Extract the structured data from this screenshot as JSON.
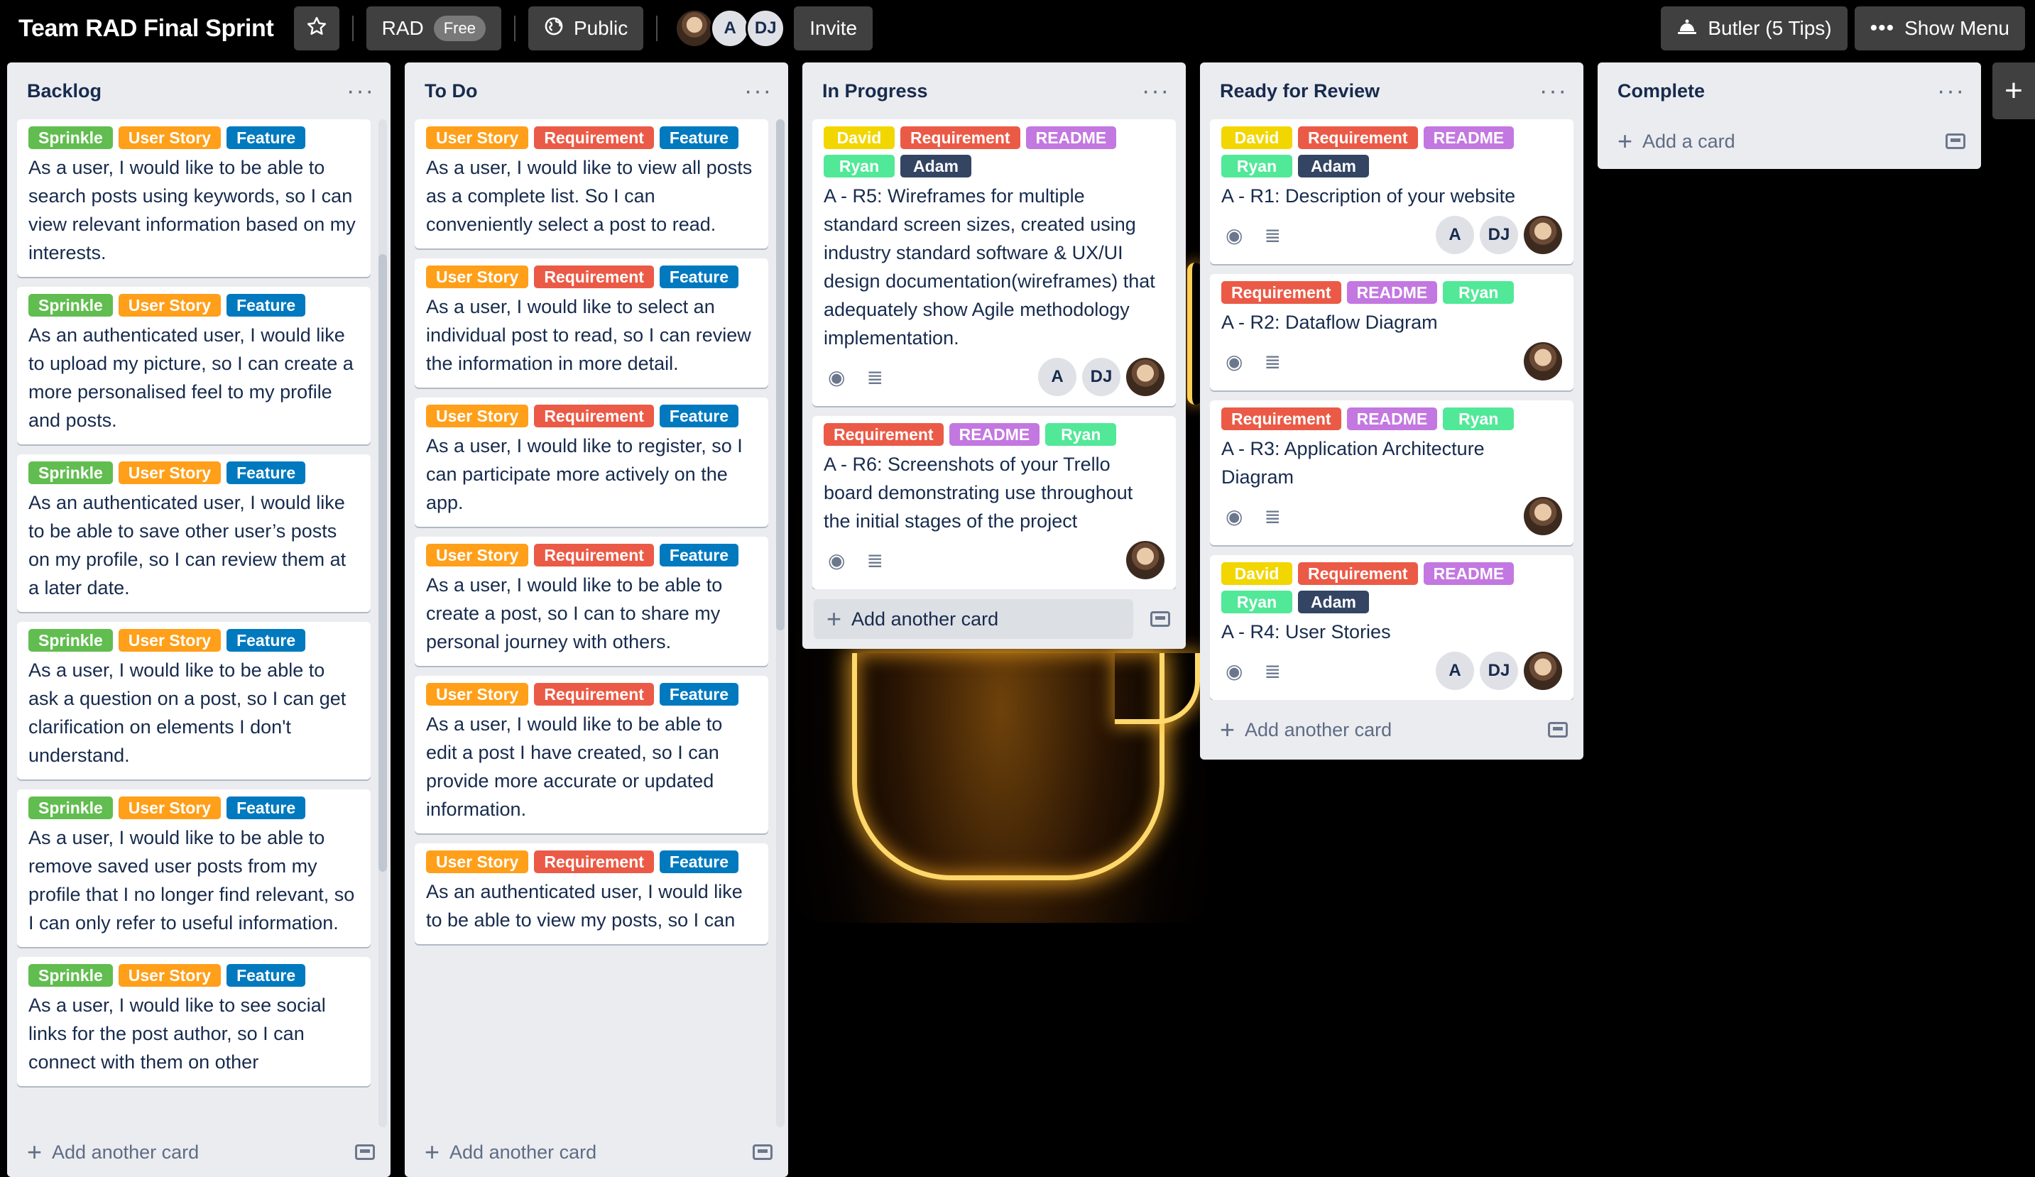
{
  "colors": {
    "sprinkle": "#61bd4f",
    "user_story": "#ff9f1a",
    "feature": "#0079bf",
    "requirement": "#eb5a46",
    "readme": "#c377e0",
    "david": "#f2d600",
    "ryan": "#51e898",
    "adam": "#344563"
  },
  "header": {
    "board_title": "Team RAD Final Sprint",
    "star_icon": "star-icon",
    "workspace": "RAD",
    "plan_badge": "Free",
    "visibility": "Public",
    "members": [
      "A",
      "DJ"
    ],
    "invite": "Invite",
    "butler": "Butler (5 Tips)",
    "show_menu": "Show Menu"
  },
  "lists": {
    "backlog": {
      "title": "Backlog",
      "add_card": "Add another card",
      "cards": [
        {
          "labels": [
            "Sprinkle",
            "User Story",
            "Feature"
          ],
          "text": "As a user, I would like to be able to search posts using keywords, so I can view relevant information based on my interests."
        },
        {
          "labels": [
            "Sprinkle",
            "User Story",
            "Feature"
          ],
          "text": "As an authenticated user, I would like to upload my picture, so I can create a more personalised feel to my profile and posts."
        },
        {
          "labels": [
            "Sprinkle",
            "User Story",
            "Feature"
          ],
          "text": "As an authenticated user, I would like to be able to save other user’s posts on my profile, so I can review them at a later date."
        },
        {
          "labels": [
            "Sprinkle",
            "User Story",
            "Feature"
          ],
          "text": "As a user, I would like to be able to ask a question on a post, so I can get clarification on elements I don't understand."
        },
        {
          "labels": [
            "Sprinkle",
            "User Story",
            "Feature"
          ],
          "text": "As a user, I would like to be able to remove saved user posts from my profile that I no longer find relevant, so I can only refer to useful information."
        },
        {
          "labels": [
            "Sprinkle",
            "User Story",
            "Feature"
          ],
          "text": "As a user, I would like to see social links for the post author, so I can connect with them on other"
        }
      ]
    },
    "todo": {
      "title": "To Do",
      "add_card": "Add another card",
      "cards": [
        {
          "labels": [
            "User Story",
            "Requirement",
            "Feature"
          ],
          "text": "As a user, I would like to view all posts as a complete list. So I can conveniently select a post to read."
        },
        {
          "labels": [
            "User Story",
            "Requirement",
            "Feature"
          ],
          "text": "As a user, I would like to select an individual post to read, so I can review the information in more detail."
        },
        {
          "labels": [
            "User Story",
            "Requirement",
            "Feature"
          ],
          "text": "As a user, I would like to register, so I can participate more actively on the app."
        },
        {
          "labels": [
            "User Story",
            "Requirement",
            "Feature"
          ],
          "text": "As a user, I would like to be able to create a post, so I can to share my personal journey with others."
        },
        {
          "labels": [
            "User Story",
            "Requirement",
            "Feature"
          ],
          "text": "As a user, I would like to be able to edit a post I have created, so I can provide more accurate or updated information."
        },
        {
          "labels": [
            "User Story",
            "Requirement",
            "Feature"
          ],
          "text": "As an authenticated user, I would like to be able to view my posts, so I can"
        }
      ]
    },
    "in_progress": {
      "title": "In Progress",
      "add_card": "Add another card",
      "cards": [
        {
          "labels": [
            "David",
            "Requirement",
            "README",
            "Ryan",
            "Adam"
          ],
          "text": "A - R5: Wireframes for multiple standard screen sizes, created using industry standard software & UX/UI design documentation(wireframes) that adequately show Agile methodology implementation.",
          "members": [
            "A",
            "DJ"
          ]
        },
        {
          "labels": [
            "Requirement",
            "README",
            "Ryan"
          ],
          "text": "A - R6: Screenshots of your Trello board demonstrating use throughout the initial stages of the project",
          "members": []
        }
      ]
    },
    "review": {
      "title": "Ready for Review",
      "add_card": "Add another card",
      "cards": [
        {
          "labels": [
            "David",
            "Requirement",
            "README",
            "Ryan",
            "Adam"
          ],
          "text": "A - R1: Description of your website",
          "members": [
            "A",
            "DJ"
          ]
        },
        {
          "labels": [
            "Requirement",
            "README",
            "Ryan"
          ],
          "text": "A - R2: Dataflow Diagram",
          "members": []
        },
        {
          "labels": [
            "Requirement",
            "README",
            "Ryan"
          ],
          "text": "A - R3: Application Architecture Diagram",
          "members": []
        },
        {
          "labels": [
            "David",
            "Requirement",
            "README",
            "Ryan",
            "Adam"
          ],
          "text": "A - R4: User Stories",
          "members": [
            "A",
            "DJ"
          ]
        }
      ]
    },
    "complete": {
      "title": "Complete",
      "add_card": "Add a card"
    }
  },
  "add_list_icon": "plus-icon"
}
